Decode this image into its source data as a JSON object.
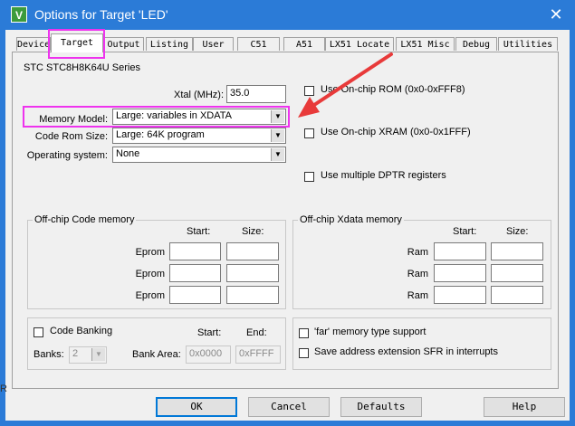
{
  "window": {
    "title": "Options for Target 'LED'",
    "close_glyph": "✕",
    "icon_letter": "V",
    "left_edge_letter": "R"
  },
  "tabs": [
    {
      "label": "Device"
    },
    {
      "label": "Target"
    },
    {
      "label": "Output"
    },
    {
      "label": "Listing"
    },
    {
      "label": "User"
    },
    {
      "label": "C51"
    },
    {
      "label": "A51"
    },
    {
      "label": "LX51 Locate"
    },
    {
      "label": "LX51 Misc"
    },
    {
      "label": "Debug"
    },
    {
      "label": "Utilities"
    }
  ],
  "active_tab": "Target",
  "target": {
    "device_name": "STC STC8H8K64U Series",
    "xtal_label": "Xtal (MHz):",
    "xtal_value": "35.0",
    "memory_model_label": "Memory Model:",
    "memory_model_value": "Large: variables in XDATA",
    "code_rom_label": "Code Rom Size:",
    "code_rom_value": "Large: 64K program",
    "os_label": "Operating system:",
    "os_value": "None",
    "options": [
      {
        "label": "Use On-chip ROM (0x0-0xFFF8)",
        "checked": false
      },
      {
        "label": "Use On-chip XRAM (0x0-0x1FFF)",
        "checked": false
      },
      {
        "label": "Use multiple DPTR registers",
        "checked": false
      }
    ]
  },
  "offchip_code": {
    "title": "Off-chip Code memory",
    "start_header": "Start:",
    "size_header": "Size:",
    "rows": [
      {
        "label": "Eprom"
      },
      {
        "label": "Eprom"
      },
      {
        "label": "Eprom"
      }
    ]
  },
  "offchip_xdata": {
    "title": "Off-chip Xdata memory",
    "start_header": "Start:",
    "size_header": "Size:",
    "rows": [
      {
        "label": "Ram"
      },
      {
        "label": "Ram"
      },
      {
        "label": "Ram"
      }
    ]
  },
  "banking": {
    "code_banking_label": "Code Banking",
    "code_banking_checked": false,
    "start_header": "Start:",
    "end_header": "End:",
    "banks_label": "Banks:",
    "banks_value": "2",
    "bank_area_label": "Bank Area:",
    "bank_area_start": "0x0000",
    "bank_area_end": "0xFFFF"
  },
  "far_options": [
    {
      "label": "'far' memory type support",
      "checked": false
    },
    {
      "label": "Save address extension SFR in interrupts",
      "checked": false
    }
  ],
  "buttons": {
    "ok": "OK",
    "cancel": "Cancel",
    "defaults": "Defaults",
    "help": "Help"
  },
  "annotation": {
    "highlight_color": "#ee33ee",
    "arrow_color": "#e83a3a"
  }
}
